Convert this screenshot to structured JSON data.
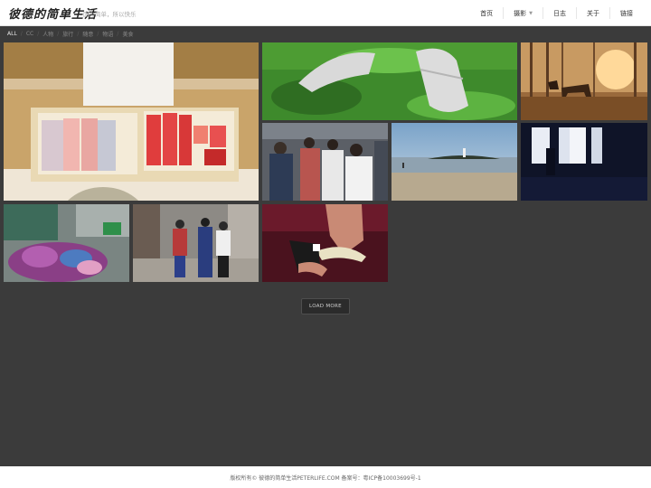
{
  "header": {
    "logo": "彼德的简单生活",
    "tagline": "因为简单，所以快乐",
    "nav": [
      {
        "label": "首页"
      },
      {
        "label": "摄影",
        "has_dropdown": true
      },
      {
        "label": "日志"
      },
      {
        "label": "关于"
      },
      {
        "label": "链接"
      }
    ]
  },
  "filters": {
    "items": [
      "ALL",
      "CC",
      "人物",
      "旅行",
      "随意",
      "物语",
      "美食"
    ],
    "active": "ALL"
  },
  "gallery": {
    "photos": [
      {
        "subject": "sushi-chef-fish-platter"
      },
      {
        "subject": "sneakers-on-grass"
      },
      {
        "subject": "horses-autumn-forest"
      },
      {
        "subject": "crowd-dancing"
      },
      {
        "subject": "beach-lighthouse"
      },
      {
        "subject": "dark-window-silhouette"
      },
      {
        "subject": "purple-flowers-market"
      },
      {
        "subject": "women-ethnic-dress-street"
      },
      {
        "subject": "hands-shoes-wedding"
      }
    ]
  },
  "load_more": {
    "label": "LOAD MORE"
  },
  "footer": {
    "text": "版权所有© 彼德的简单生活PETERLIFE.COM 备案号：粤ICP备10003699号-1"
  },
  "colors": {
    "background": "#3b3b3b",
    "header_bg": "#ffffff",
    "filter_active": "#e6e6e6"
  }
}
